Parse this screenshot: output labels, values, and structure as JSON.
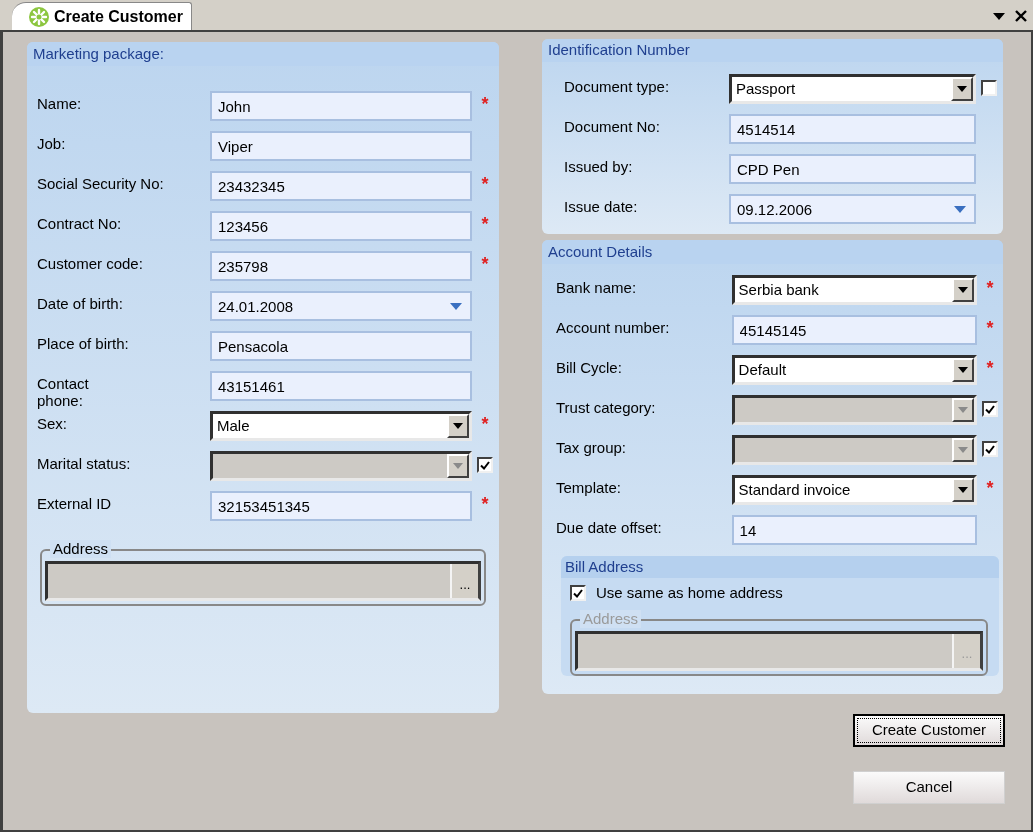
{
  "tab": {
    "title": "Create Customer"
  },
  "marketing": {
    "title": "Marketing package:",
    "fields": [
      {
        "kind": "text",
        "label": "Name:",
        "value": "John",
        "required_mark": "*"
      },
      {
        "kind": "text",
        "label": "Job:",
        "value": "Viper"
      },
      {
        "kind": "text",
        "label": "Social Security No:",
        "value": "23432345",
        "required_mark": "*"
      },
      {
        "kind": "text",
        "label": "Contract No:",
        "value": "123456",
        "required_mark": "*"
      },
      {
        "kind": "text",
        "label": "Customer code:",
        "value": "235798",
        "required_mark": "*"
      },
      {
        "kind": "date",
        "label": "Date of birth:",
        "value": "24.01.2008"
      },
      {
        "kind": "text",
        "label": "Place of birth:",
        "value": "Pensacola"
      },
      {
        "kind": "text",
        "label": "Contact\nphone:",
        "value": "43151461"
      },
      {
        "kind": "select",
        "label": "Sex:",
        "value": "Male",
        "disabled": false,
        "required_mark": "*"
      },
      {
        "kind": "select",
        "label": "Marital status:",
        "disabled": true,
        "checkbox": {
          "checked": true
        }
      },
      {
        "kind": "text",
        "label": "External ID",
        "value": "32153451345",
        "required_mark": "*"
      }
    ],
    "address": {
      "legend": "Address",
      "browse": "...",
      "disabled": false
    }
  },
  "identification": {
    "title": "Identification Number",
    "fields": [
      {
        "kind": "select",
        "label": "Document type:",
        "value": "Passport",
        "disabled": false,
        "checkbox": {
          "checked": false
        }
      },
      {
        "kind": "text",
        "label": "Document No:",
        "value": "4514514"
      },
      {
        "kind": "text",
        "label": "Issued by:",
        "value": "CPD Pen"
      },
      {
        "kind": "date",
        "label": "Issue date:",
        "value": "09.12.2006"
      }
    ]
  },
  "account": {
    "title": "Account Details",
    "fields": [
      {
        "kind": "select",
        "label": "Bank name:",
        "value": "Serbia bank",
        "disabled": false,
        "required_mark": "*"
      },
      {
        "kind": "text",
        "label": "Account number:",
        "value": "45145145",
        "required_mark": "*"
      },
      {
        "kind": "select",
        "label": "Bill Cycle:",
        "value": "Default",
        "disabled": false,
        "required_mark": "*"
      },
      {
        "kind": "select",
        "label": "Trust category:",
        "disabled": true,
        "checkbox": {
          "checked": true
        }
      },
      {
        "kind": "select",
        "label": "Tax group:",
        "disabled": true,
        "checkbox": {
          "checked": true
        }
      },
      {
        "kind": "select",
        "label": "Template:",
        "value": "Standard invoice",
        "disabled": false,
        "required_mark": "*"
      },
      {
        "kind": "text",
        "label": "Due  date offset:",
        "value": "14"
      }
    ],
    "bill_address": {
      "title": "Bill Address",
      "same_as_home": {
        "label": "Use same as home address",
        "checked": true
      },
      "address": {
        "legend": "Address",
        "browse": "...",
        "disabled": true
      }
    }
  },
  "buttons": [
    {
      "label": "Create Customer",
      "focused": true
    },
    {
      "label": "Cancel",
      "focused": false
    }
  ]
}
